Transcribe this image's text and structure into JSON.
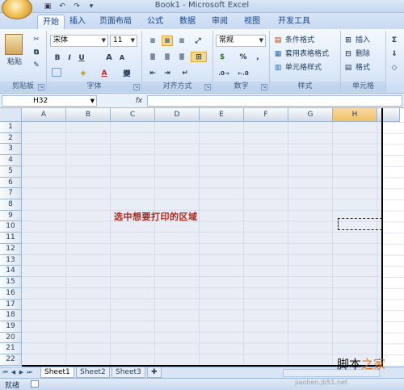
{
  "window": {
    "title": "Book1 - Microsoft Excel"
  },
  "tabs": [
    "开始",
    "插入",
    "页面布局",
    "公式",
    "数据",
    "审阅",
    "视图",
    "开发工具"
  ],
  "ribbon": {
    "clipboard": {
      "paste": "粘贴",
      "label": "剪贴板"
    },
    "font": {
      "name": "宋体",
      "size": "11",
      "bold": "B",
      "italic": "I",
      "underline": "U",
      "grow": "A",
      "shrink": "A",
      "label": "字体"
    },
    "alignment": {
      "label": "对齐方式"
    },
    "number": {
      "format": "常规",
      "percent": "%",
      "comma": ",",
      "label": "数字"
    },
    "styles": {
      "conditional": "条件格式",
      "table": "套用表格格式",
      "cell": "单元格样式",
      "label": "样式"
    },
    "cells": {
      "insert": "插入",
      "delete": "删除",
      "format": "格式",
      "label": "单元格"
    }
  },
  "formula_bar": {
    "name_box": "H32",
    "fx": "fx"
  },
  "columns": [
    "A",
    "B",
    "C",
    "D",
    "E",
    "F",
    "G",
    "H"
  ],
  "rows": [
    "1",
    "2",
    "3",
    "4",
    "5",
    "6",
    "7",
    "8",
    "9",
    "10",
    "11",
    "12",
    "13",
    "14",
    "15",
    "16",
    "17",
    "18",
    "19",
    "20",
    "21",
    "22"
  ],
  "annotation": "选中想要打印的区域",
  "sheets": [
    "Sheet1",
    "Sheet2",
    "Sheet3"
  ],
  "status": {
    "ready": "就绪"
  },
  "watermark": {
    "brand_a": "脚本",
    "brand_b": "之家",
    "url": "jiaoben.jb51.net"
  }
}
